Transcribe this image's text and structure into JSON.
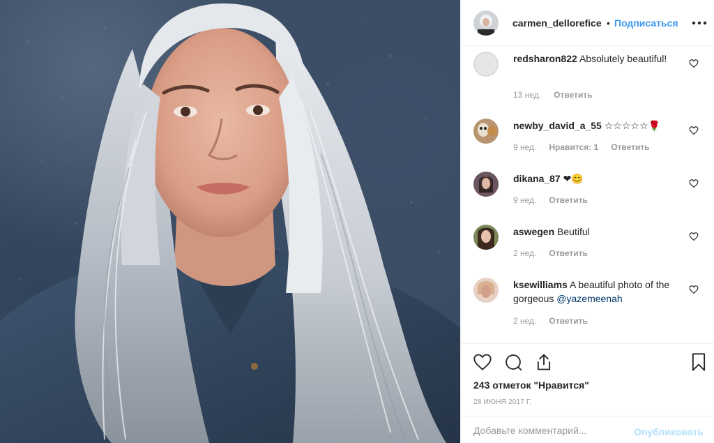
{
  "post": {
    "image_alt": "portrait photo"
  },
  "header": {
    "username": "carmen_dellorefice",
    "dot": "•",
    "follow_label": "Подписаться",
    "more_icon": "more-dots-icon"
  },
  "comments": [
    {
      "username": "redsharon822",
      "text": "Absolutely beautiful!",
      "mention": "",
      "time": "13 нед.",
      "likes": "",
      "reply": "Ответить"
    },
    {
      "username": "newby_david_a_55",
      "text": "☆☆☆☆☆🌹",
      "mention": "",
      "time": "9 нед.",
      "likes": "Нравится: 1",
      "reply": "Ответить"
    },
    {
      "username": "dikana_87",
      "text": "❤😊",
      "mention": "",
      "time": "9 нед.",
      "likes": "",
      "reply": "Ответить"
    },
    {
      "username": "aswegen",
      "text": "Beutiful",
      "mention": "",
      "time": "2 нед.",
      "likes": "",
      "reply": "Ответить"
    },
    {
      "username": "ksewilliams",
      "text": "A beautiful photo of the gorgeous",
      "mention": "@yazemeenah",
      "time": "2 нед.",
      "likes": "",
      "reply": "Ответить"
    }
  ],
  "actions": {
    "likes_label": "243 отметок \"Нравится\"",
    "date": "28 ИЮНЯ 2017 Г."
  },
  "add_comment": {
    "placeholder": "Добавьте комментарий...",
    "publish_label": "Опубликовать"
  },
  "colors": {
    "accent": "#3897f0",
    "publish_disabled": "#b2dffc",
    "meta_gray": "#999999",
    "text": "#262626"
  }
}
